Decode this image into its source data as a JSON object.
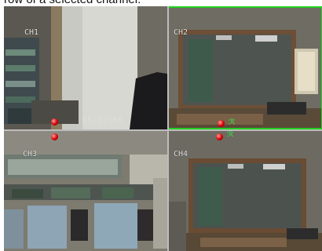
{
  "caption": "row of a selected channel.",
  "channels": [
    {
      "label": "CH1",
      "recording": true,
      "motion": false,
      "selected": false
    },
    {
      "label": "CH2",
      "recording": true,
      "motion": true,
      "selected": true
    },
    {
      "label": "CH3",
      "recording": true,
      "motion": false,
      "selected": false
    },
    {
      "label": "CH4",
      "recording": false,
      "motion": false,
      "selected": false
    }
  ],
  "ch1_timestamp": "15:52:00",
  "colors": {
    "selection_border": "#22d022",
    "record_indicator": "#d40000",
    "motion_indicator": "#3bd14a"
  }
}
